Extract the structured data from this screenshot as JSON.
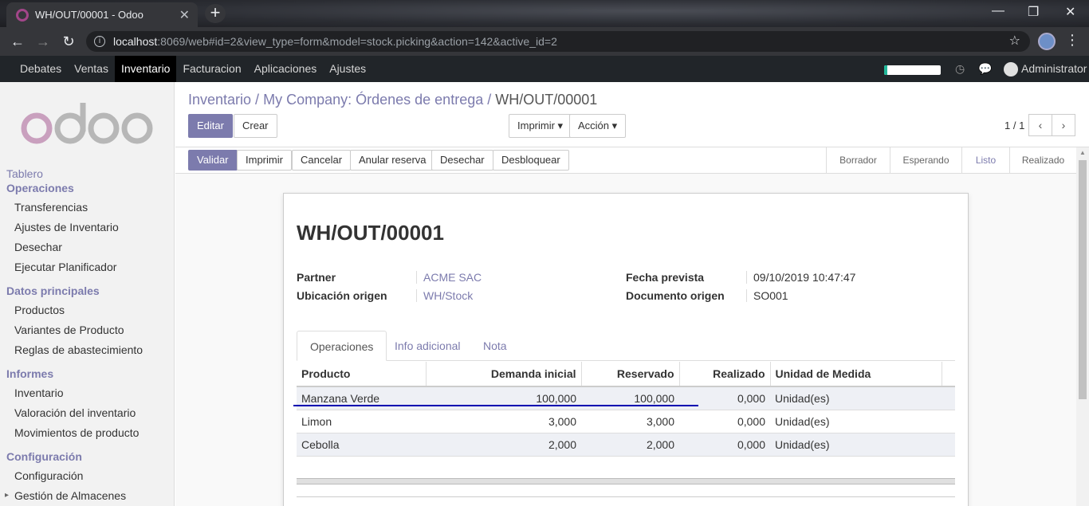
{
  "browser": {
    "tab_title": "WH/OUT/00001 - Odoo",
    "tab_close": "✕",
    "new_tab": "+",
    "url_host": "localhost",
    "url_rest": ":8069/web#id=2&view_type=form&model=stock.picking&action=142&active_id=2",
    "win_min": "—",
    "win_restore": "❐",
    "win_close": "✕"
  },
  "topnav": {
    "items": [
      "Debates",
      "Ventas",
      "Inventario",
      "Facturacion",
      "Aplicaciones",
      "Ajustes"
    ],
    "active": "Inventario",
    "user": "Administrator"
  },
  "sidebar": {
    "tablero": "Tablero",
    "operaciones": {
      "title": "Operaciones",
      "items": [
        "Transferencias",
        "Ajustes de Inventario",
        "Desechar",
        "Ejecutar Planificador"
      ]
    },
    "datos": {
      "title": "Datos principales",
      "items": [
        "Productos",
        "Variantes de Producto",
        "Reglas de abastecimiento"
      ]
    },
    "informes": {
      "title": "Informes",
      "items": [
        "Inventario",
        "Valoración del inventario",
        "Movimientos de producto"
      ]
    },
    "config": {
      "title": "Configuración",
      "items": [
        "Configuración",
        "Gestión de Almacenes"
      ]
    }
  },
  "breadcrumb": {
    "part1": "Inventario /",
    "part2": "My Company: Órdenes de entrega /",
    "current": "WH/OUT/00001"
  },
  "control": {
    "edit": "Editar",
    "create": "Crear",
    "print": "Imprimir ▾",
    "action": "Acción ▾",
    "pager": "1 / 1",
    "prev": "‹",
    "next": "›"
  },
  "status_buttons": {
    "validate": "Validar",
    "print": "Imprimir",
    "cancel": "Cancelar",
    "unreserve": "Anular reserva",
    "scrap": "Desechar",
    "unlock": "Desbloquear"
  },
  "stages": [
    "Borrador",
    "Esperando",
    "Listo",
    "Realizado"
  ],
  "active_stage": "Listo",
  "record": {
    "name": "WH/OUT/00001",
    "partner_label": "Partner",
    "partner": "ACME SAC",
    "loc_label": "Ubicación origen",
    "loc": "WH/Stock",
    "date_label": "Fecha prevista",
    "date": "09/10/2019 10:47:47",
    "origin_label": "Documento origen",
    "origin": "SO001"
  },
  "notebook": {
    "tabs": [
      "Operaciones",
      "Info adicional",
      "Nota"
    ]
  },
  "lines": {
    "headers": [
      "Producto",
      "Demanda inicial",
      "Reservado",
      "Realizado",
      "Unidad de Medida"
    ],
    "rows": [
      [
        "Manzana Verde",
        "100,000",
        "100,000",
        "0,000",
        "Unidad(es)"
      ],
      [
        "Limon",
        "3,000",
        "3,000",
        "0,000",
        "Unidad(es)"
      ],
      [
        "Cebolla",
        "2,000",
        "2,000",
        "0,000",
        "Unidad(es)"
      ]
    ]
  }
}
